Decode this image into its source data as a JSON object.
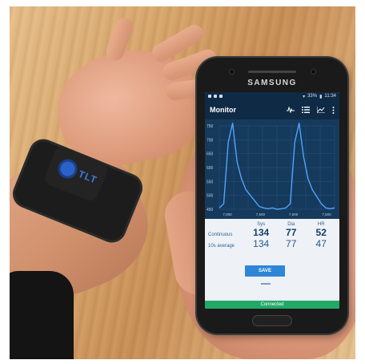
{
  "phone": {
    "brand": "SAMSUNG",
    "status_bar": {
      "battery": "33%",
      "time": "11:34"
    },
    "app": {
      "title": "Monitor",
      "toolbar_icons": [
        "waveform-icon",
        "list-icon",
        "chart-icon",
        "more-vert-icon"
      ]
    },
    "plot": {
      "y_ticks": [
        "750",
        "700",
        "650",
        "600",
        "550",
        "500",
        "450"
      ],
      "x_ticks": [
        "7,000",
        "7,500",
        "7,000",
        "7,500"
      ]
    },
    "table": {
      "headers": [
        "Sys",
        "Dia",
        "HR"
      ],
      "rows": [
        {
          "label": "Continuous",
          "values": [
            "134",
            "77",
            "52"
          ]
        },
        {
          "label": "10s average",
          "values": [
            "134",
            "77",
            "47"
          ]
        }
      ]
    },
    "save_label": "SAVE",
    "connection_status": "Connected"
  },
  "wrist_device": {
    "logo": "TLT"
  },
  "colors": {
    "app_bar": "#0f2a45",
    "plot_bg": "#153a5c",
    "trace": "#4fa3ff",
    "save_button": "#2f86d6",
    "connected_bar": "#22a968"
  },
  "chart_data": {
    "type": "line",
    "y_range": [
      450,
      750
    ],
    "series": [
      {
        "values": [
          455,
          470,
          690,
          760,
          620,
          560,
          520,
          500,
          480,
          460,
          455,
          452,
          455,
          450,
          452,
          455,
          470,
          690,
          760,
          640,
          560,
          520,
          495,
          470,
          455,
          452,
          455
        ]
      }
    ]
  }
}
